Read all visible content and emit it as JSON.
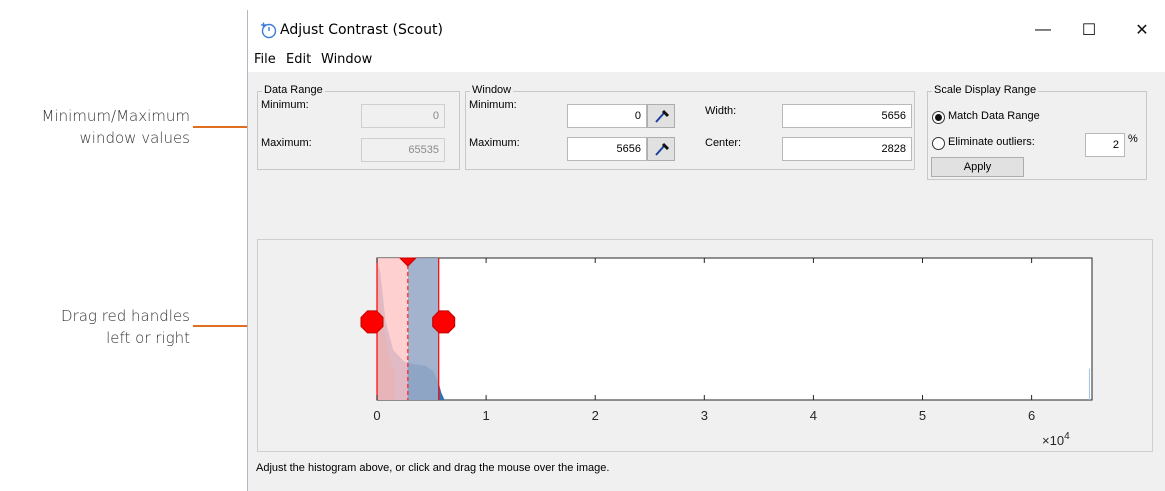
{
  "callouts": {
    "window_values": [
      "Minimum/Maximum",
      "window values"
    ],
    "drag_handles": [
      "Drag red handles",
      "left or right"
    ]
  },
  "window": {
    "title": "Adjust Contrast (Scout)",
    "controls": {
      "minimize": "—",
      "maximize": "☐",
      "close": "✕"
    }
  },
  "menu": [
    "File",
    "Edit",
    "Window"
  ],
  "data_range": {
    "label": "Data Range",
    "min_label": "Minimum:",
    "min_value": "0",
    "max_label": "Maximum:",
    "max_value": "65535"
  },
  "window_group": {
    "label": "Window",
    "min_label": "Minimum:",
    "min_value": "0",
    "max_label": "Maximum:",
    "max_value": "5656",
    "width_label": "Width:",
    "width_value": "5656",
    "center_label": "Center:",
    "center_value": "2828"
  },
  "scale": {
    "label": "Scale Display Range",
    "match_label": "Match Data Range",
    "match_selected": true,
    "eliminate_label": "Eliminate outliers:",
    "outlier_value": "2",
    "percent": "%",
    "apply_label": "Apply"
  },
  "chart_data": {
    "type": "area",
    "x_ticks": [
      "0",
      "1",
      "2",
      "3",
      "4",
      "5",
      "6"
    ],
    "x_tick_values": [
      0,
      10000,
      20000,
      30000,
      40000,
      50000,
      60000
    ],
    "x_exponent_label": "×10",
    "x_exponent": "4",
    "xlim": [
      0,
      65535
    ],
    "window_min": 0,
    "window_max": 5656,
    "window_center": 2828,
    "histogram": [
      {
        "x": 0,
        "y": 0.98
      },
      {
        "x": 300,
        "y": 0.9
      },
      {
        "x": 800,
        "y": 0.55
      },
      {
        "x": 1500,
        "y": 0.35
      },
      {
        "x": 2500,
        "y": 0.27
      },
      {
        "x": 3500,
        "y": 0.25
      },
      {
        "x": 4500,
        "y": 0.24
      },
      {
        "x": 5200,
        "y": 0.2
      },
      {
        "x": 5656,
        "y": 0.12
      },
      {
        "x": 5900,
        "y": 0.05
      },
      {
        "x": 6200,
        "y": 0.0
      }
    ],
    "colors": {
      "fill": "#2f75b5",
      "window": "#ff0000",
      "window_fill": "#ffc8c8"
    }
  },
  "status_text": "Adjust the histogram above, or click and drag the mouse over the image."
}
